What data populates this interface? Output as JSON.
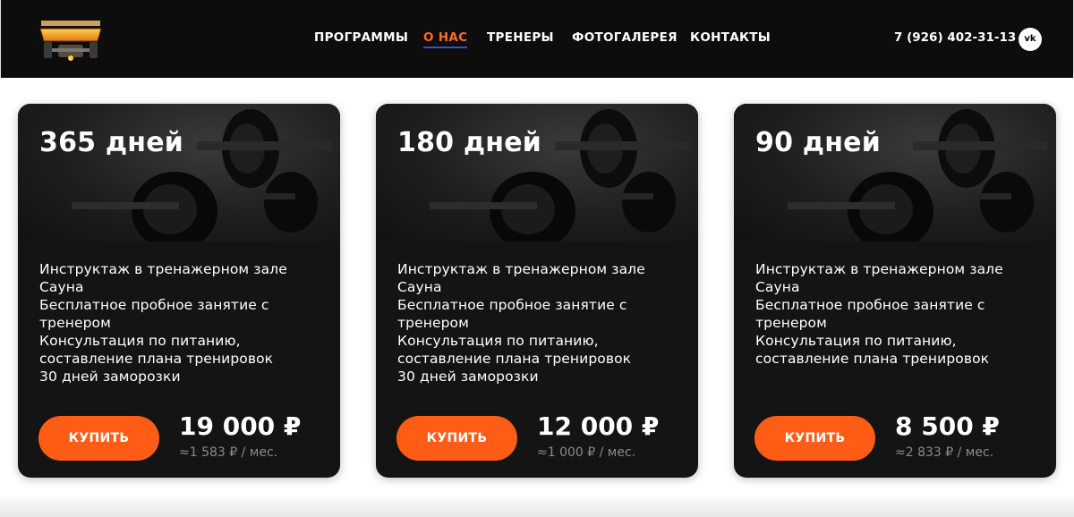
{
  "header": {
    "logo_alt": "СПОРТКЛУБ БОГАТЫРЬ",
    "nav": [
      {
        "label": "ПРОГРАММЫ",
        "active": false
      },
      {
        "label": "О НАС",
        "active": true
      },
      {
        "label": "ТРЕНЕРЫ",
        "active": false
      },
      {
        "label": "ФОТОГАЛЕРЕЯ",
        "active": false
      },
      {
        "label": "КОНТАКТЫ",
        "active": false
      }
    ],
    "phone": "7 (926) 402-31-13",
    "social": "vk"
  },
  "cards": [
    {
      "title": "365 дней",
      "features": [
        "Инструктаж в тренажерном зале",
        "Сауна",
        "Бесплатное пробное занятие с тренером",
        "Консультация по питанию, составление плана тренировок",
        "30 дней заморозки"
      ],
      "buy_label": "КУПИТЬ",
      "price": "19 000 ₽",
      "price_month": "≈1 583 ₽ / мес."
    },
    {
      "title": "180 дней",
      "features": [
        "Инструктаж в тренажерном зале",
        "Сауна",
        "Бесплатное пробное занятие с тренером",
        "Консультация по питанию, составление плана тренировок",
        "30 дней заморозки"
      ],
      "buy_label": "КУПИТЬ",
      "price": "12 000 ₽",
      "price_month": "≈1 000 ₽ / мес."
    },
    {
      "title": "90 дней",
      "features": [
        "Инструктаж в тренажерном зале",
        "Сауна",
        "Бесплатное пробное занятие с тренером",
        "Консультация по питанию, составление плана тренировок"
      ],
      "buy_label": "КУПИТЬ",
      "price": "8 500 ₽",
      "price_month": "≈2 833 ₽ / мес."
    }
  ],
  "colors": {
    "accent": "#ff5c16",
    "header_bg": "#0d0d0d",
    "card_bg": "#141414",
    "active_underline": "#3a4bd6"
  }
}
